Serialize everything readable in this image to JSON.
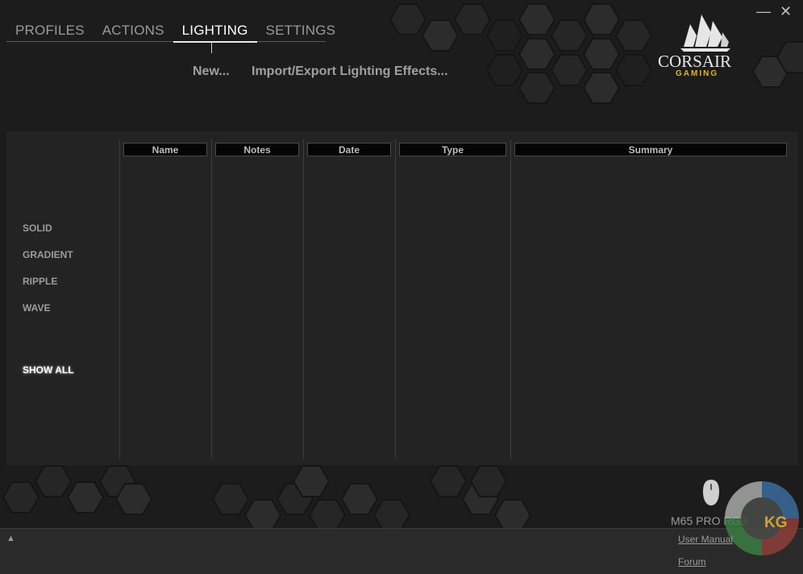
{
  "nav": {
    "tabs": [
      {
        "label": "PROFILES"
      },
      {
        "label": "ACTIONS"
      },
      {
        "label": "LIGHTING"
      },
      {
        "label": "SETTINGS"
      }
    ],
    "active_tab": "LIGHTING"
  },
  "window": {
    "minimize_label": "—",
    "close_label": "✕"
  },
  "subactions": {
    "new_label": "New...",
    "import_export_label": "Import/Export Lighting Effects..."
  },
  "brand": {
    "logo_text": "CORSAIR",
    "logo_subtext": "GAMING",
    "accent": "#e3b12a"
  },
  "filters": {
    "items": [
      "SOLID",
      "GRADIENT",
      "RIPPLE",
      "WAVE"
    ],
    "show_all": "SHOW ALL"
  },
  "table": {
    "columns": [
      "Name",
      "Notes",
      "Date",
      "Type",
      "Summary"
    ],
    "rows": []
  },
  "footer": {
    "device_name": "M65 PRO RGB",
    "user_manual_label": "User Manual",
    "forum_label": "Forum",
    "collapse_icon": "triangle-up-icon"
  },
  "watermark": {
    "text": "KG"
  }
}
